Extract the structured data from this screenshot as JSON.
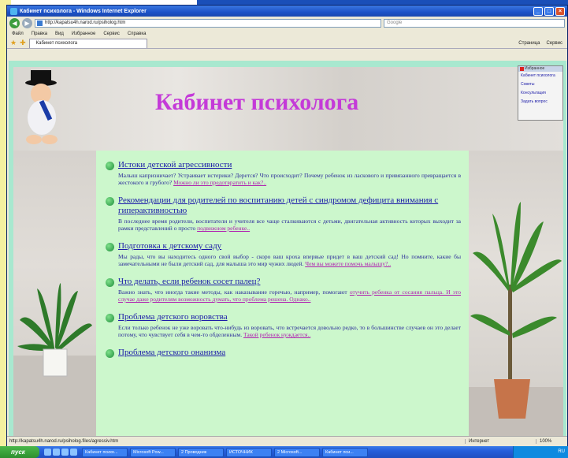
{
  "window": {
    "title": "Кабинет психолога - Windows Internet Explorer"
  },
  "address": {
    "url": "http://kapatsu4h.narod.ru/psiholog.htm",
    "search_placeholder": "Google"
  },
  "menu": [
    "Файл",
    "Правка",
    "Вид",
    "Избранное",
    "Сервис",
    "Справка"
  ],
  "tab": {
    "label": "Кабинет психолога"
  },
  "tab_tools": [
    "Страница",
    "Сервис"
  ],
  "page": {
    "title": "Кабинет психолога",
    "items": [
      {
        "title": "Истоки детской агрессивности",
        "text": "Малыш капризничает? Устраивает истерики? Дерется? Что происходит? Почему ребенок из ласкового и привязанного превращается в жестокого и грубого?",
        "more": "Можно ли это предотвратить и как?.."
      },
      {
        "title": "Рекомендации для родителей по воспитанию детей с синдромом дефицита внимания с гиперактивностью",
        "text": "В последнее время родители, воспитатели и учителя все чаще сталкиваются с детьми, двигательная активность которых выходит за рамки представлений о просто",
        "more": "подвижном ребенке.."
      },
      {
        "title": "Подготовка к детскому саду",
        "text": "Мы рады, что вы находитесь одного свой выбор - скоро ваш кроха впервые придет в ваш детский сад! Но помните, какие бы замечательными не были детский сад, для малыша это мир чужих людей.",
        "more": "Чем вы можете помочь малышу?.."
      },
      {
        "title": "Что делать, если ребенок сосет палец?",
        "text": "Важно знать, что иногда такие методы, как наказывание горечью, например, помогают",
        "more": "отучить ребенка от сосания пальца. И это случае даже родителям возможность думать, что проблема решена. Однако..",
        "tail": ""
      },
      {
        "title": "Проблема детского воровства",
        "text": "Если только ребенок не уже воровать что-нибудь из воровать, что встречается довольно редко, то в большинстве случаев он это делает потому, что чувствует себя в чем-то обделенным.",
        "more": "Такой ребенок нуждается.."
      },
      {
        "title": "Проблема детского онанизма",
        "text": "",
        "more": ""
      }
    ]
  },
  "fav_box": {
    "header": "Избранное",
    "lines": [
      "Кабинет психолога",
      "Советы",
      "Консультация",
      "Задать вопрос"
    ]
  },
  "status": {
    "url": "http://kapatsu4h.narod.ru/psiholog.files/agressiv.htm",
    "zone": "Интернет",
    "zoom": "100%"
  },
  "taskbar": {
    "start": "пуск",
    "tasks": [
      "Кабинет психо...",
      "Microsoft Pow...",
      "2 Проводник",
      "ИСТОЧНИК",
      "2 Microsoft...",
      "Кабинет пси..."
    ],
    "clock": "RU"
  }
}
